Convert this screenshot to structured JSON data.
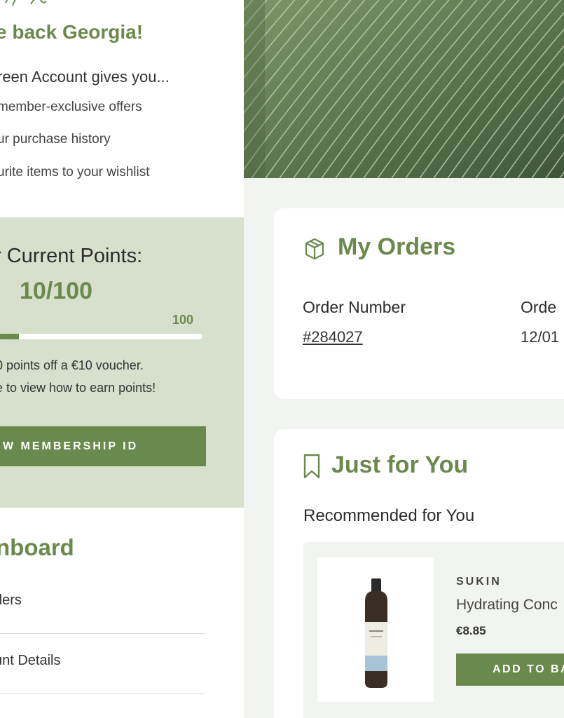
{
  "welcome": {
    "title": "e back Georgia!",
    "gives": "reen Account gives you...",
    "perks": [
      "member-exclusive offers",
      "ur purchase history",
      "urite items to your wishlist"
    ]
  },
  "points": {
    "title": "r Current Points:",
    "value": "10/100",
    "max_label": "100",
    "progress_fraction": 0.1,
    "note_1": "0 points off a €10 voucher.",
    "note_2": "e to view how to earn points!",
    "membership_button": "W MEMBERSHIP ID"
  },
  "dashboard": {
    "title": "nboard",
    "items": [
      "ders",
      "unt Details"
    ]
  },
  "orders": {
    "title": "My Orders",
    "icon": "box-icon",
    "order_number_label": "Order Number",
    "order_number_value": "#284027",
    "order_date_label": "Orde",
    "order_date_value": "12/01"
  },
  "for_you": {
    "title": "Just for You",
    "icon": "bookmark-icon",
    "recommended_heading": "Recommended for You",
    "product": {
      "brand": "SUKIN",
      "name": "Hydrating Conc",
      "price": "€8.85",
      "add_button": "ADD TO BA"
    }
  },
  "colors": {
    "accent_green": "#6a8a4d",
    "points_bg": "#d6e0cc",
    "page_bg": "#f2f4f1"
  }
}
